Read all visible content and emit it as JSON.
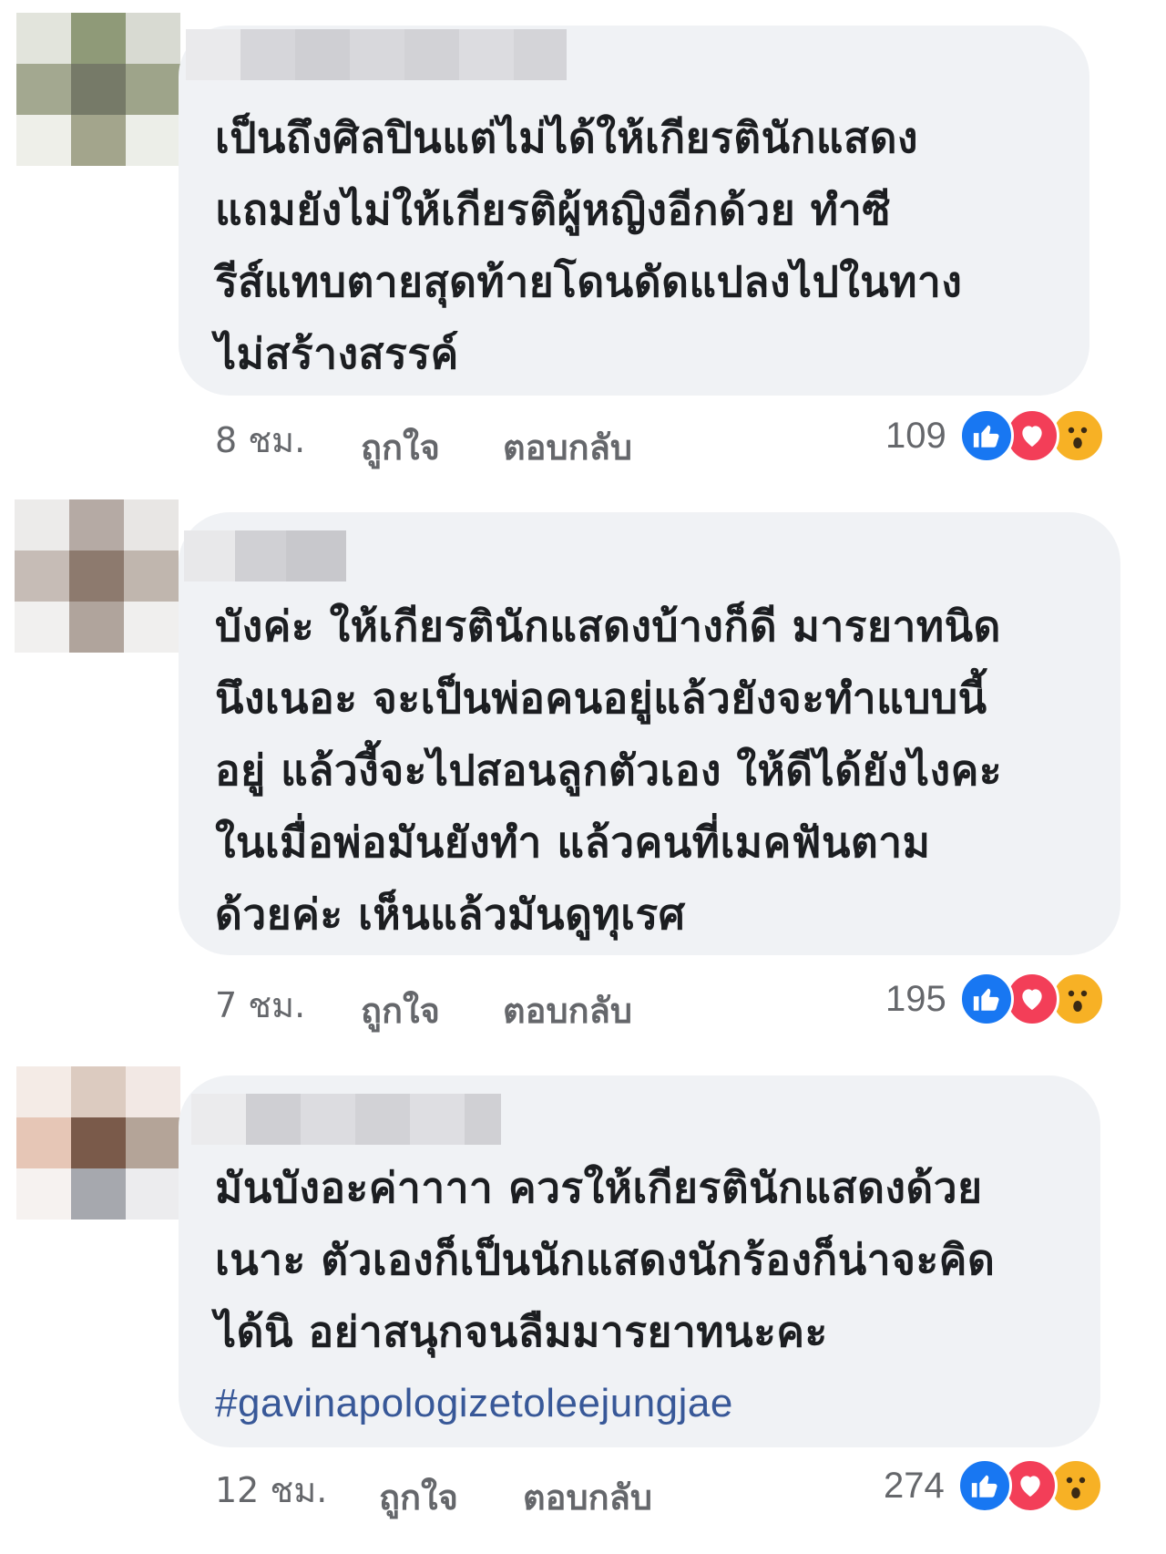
{
  "comments": [
    {
      "text": "เป็นถึงศิลปินแต่ไม่ได้ให้เกียรตินักแสดง\nแถมยังไม่ให้เกียรติผู้หญิงอีกด้วย ทำซี\nรีส์แทบตายสุดท้ายโดนดัดแปลงไปในทาง\nไม่สร้างสรรค์",
      "hashtag": "",
      "time": "8 ชม.",
      "like_label": "ถูกใจ",
      "reply_label": "ตอบกลับ",
      "reaction_count": "109"
    },
    {
      "text": "บังค่ะ ให้เกียรตินักแสดงบ้างก็ดี มารยาทนิด\nนึงเนอะ จะเป็นพ่อคนอยู่แล้วยังจะทำแบบนี้\nอยู่ แล้วงี้จะไปสอนลูกตัวเอง ให้ดีได้ยังไงคะ\nในเมื่อพ่อมันยังทำ แล้วคนที่เมคฟันตาม\nด้วยค่ะ เห็นแล้วมันดูทุเรศ",
      "hashtag": "",
      "time": "7 ชม.",
      "like_label": "ถูกใจ",
      "reply_label": "ตอบกลับ",
      "reaction_count": "195"
    },
    {
      "text": "มันบังอะค่าาาา ควรให้เกียรตินักแสดงด้วย\nเนาะ ตัวเองก็เป็นนักแสดงนักร้องก็น่าจะคิด\nได้นิ อย่าสนุกจนลืมมารยาทนะคะ",
      "hashtag": "#gavinapologizetoleejungjae",
      "time": "12 ชม.",
      "like_label": "ถูกใจ",
      "reply_label": "ตอบกลับ",
      "reaction_count": "274"
    }
  ],
  "reaction_icons": [
    "like-icon",
    "love-icon",
    "wow-icon"
  ],
  "colors": {
    "bubble": "#f0f2f5",
    "meta_text": "#65676b",
    "hashtag": "#385898",
    "like": "#1877f2",
    "love": "#f33e58",
    "wow": "#f7b125"
  }
}
